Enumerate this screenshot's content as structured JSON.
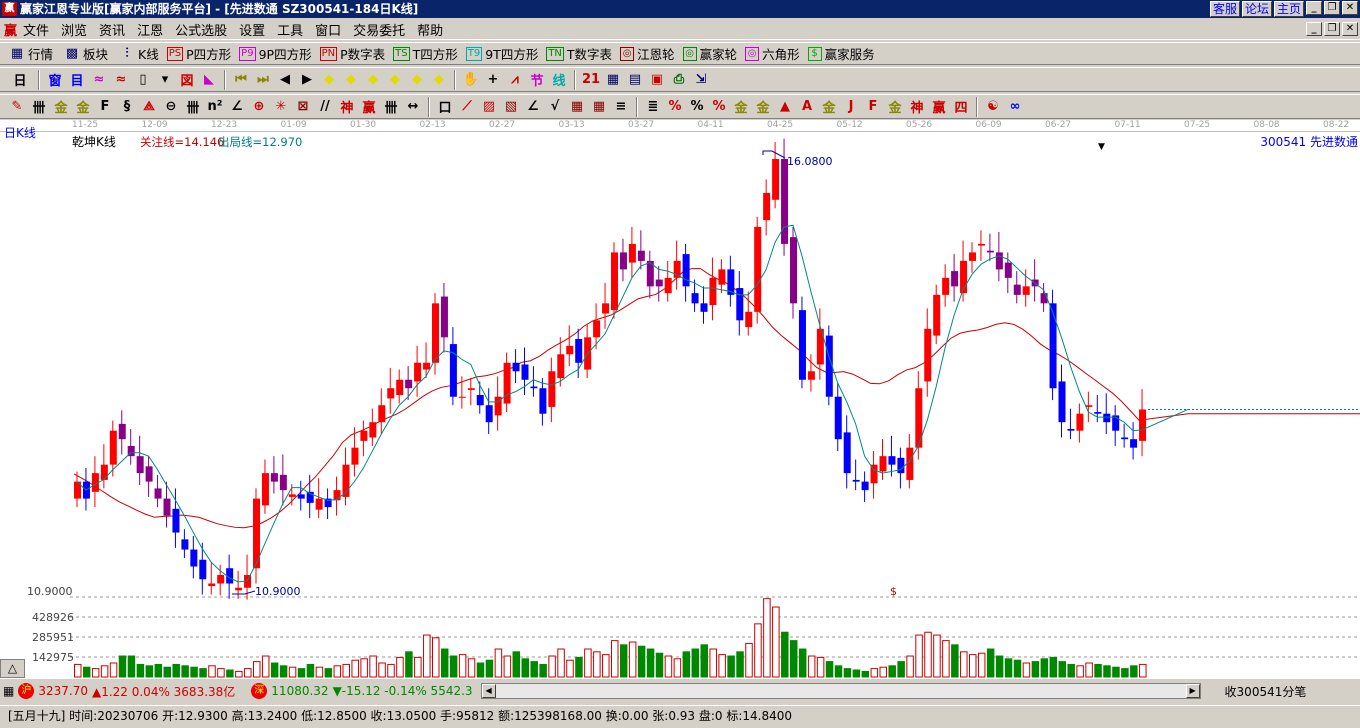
{
  "window": {
    "title": "赢家江恩专业版[赢家内部服务平台] - [先进数通   SZ300541-184日K线]",
    "logo": "赢",
    "links": [
      "客服",
      "论坛",
      "主页"
    ]
  },
  "menu": {
    "logo": "赢",
    "items": [
      "文件",
      "浏览",
      "资讯",
      "江恩",
      "公式选股",
      "设置",
      "工具",
      "窗口",
      "交易委托",
      "帮助"
    ]
  },
  "toolbar1": [
    {
      "icon": "PS",
      "label": "P四方形",
      "color": "#c00"
    },
    {
      "icon": "P9",
      "label": "9P四方形",
      "color": "#c0c"
    },
    {
      "icon": "PN",
      "label": "P数字表",
      "color": "#c00"
    },
    {
      "icon": "TS",
      "label": "T四方形",
      "color": "#080"
    },
    {
      "icon": "T9",
      "label": "9T四方形",
      "color": "#0aa"
    },
    {
      "icon": "TN",
      "label": "T数字表",
      "color": "#080"
    },
    {
      "icon": "◎",
      "label": "江恩轮",
      "color": "#800"
    },
    {
      "icon": "◎",
      "label": "赢家轮",
      "color": "#080"
    },
    {
      "icon": "◎",
      "label": "六角形",
      "color": "#c0c"
    },
    {
      "icon": "$",
      "label": "赢家服务",
      "color": "#0a0"
    }
  ],
  "toolbar1_fixed": [
    {
      "icon": "▦",
      "label": "行情"
    },
    {
      "icon": "▩",
      "label": "板块"
    },
    {
      "icon": "⫶",
      "label": "K线"
    }
  ],
  "toolbar2": {
    "period": "日",
    "icons": [
      [
        "window-icon",
        "窗",
        "#00f"
      ],
      [
        "notes-icon",
        "目",
        "#00f"
      ],
      [
        "wave3-icon",
        "≈",
        "#c0c"
      ],
      [
        "wave9-icon",
        "≈",
        "#c00"
      ],
      [
        "candle-icon",
        "▯",
        "#000"
      ],
      [
        "select-icon",
        "▾",
        "#000"
      ],
      [
        "indicator-icon",
        "図",
        "#c00"
      ],
      [
        "flag-icon",
        "◣",
        "#c0c"
      ],
      [
        "|sep",
        "",
        ""
      ],
      [
        "first-icon",
        "⏮",
        "#880"
      ],
      [
        "last-icon",
        "⏭",
        "#880"
      ],
      [
        "prev-icon",
        "◀",
        "#000"
      ],
      [
        "next-icon",
        "▶",
        "#000"
      ],
      [
        "left-icon",
        "◆",
        "#dd0"
      ],
      [
        "right-icon",
        "◆",
        "#dd0"
      ],
      [
        "expand-icon",
        "◆",
        "#dd0"
      ],
      [
        "shrink-icon",
        "◆",
        "#dd0"
      ],
      [
        "zoom-in-icon",
        "◆",
        "#dd0"
      ],
      [
        "zoom-out-icon",
        "◆",
        "#dd0"
      ],
      [
        "|sep",
        "",
        ""
      ],
      [
        "hand-icon",
        "✋",
        "#000"
      ],
      [
        "cross-icon",
        "+",
        "#000"
      ],
      [
        "line-icon",
        "⩘",
        "#c00"
      ],
      [
        "jie-icon",
        "节",
        "#c0c"
      ],
      [
        "fen-icon",
        "线",
        "#0aa"
      ],
      [
        "|sep",
        "",
        ""
      ],
      [
        "calendar-icon",
        "21",
        "#c00"
      ],
      [
        "calculator-icon",
        "▦",
        "#006"
      ],
      [
        "report-icon",
        "▤",
        "#006"
      ],
      [
        "save-icon",
        "▣",
        "#c00"
      ],
      [
        "print-icon",
        "⎙",
        "#060"
      ],
      [
        "export-icon",
        "⇲",
        "#006"
      ]
    ]
  },
  "toolbar3": {
    "icons": [
      [
        "pen-icon",
        "✎",
        "#c00"
      ],
      [
        "parallel-icon",
        "卌",
        "#000"
      ],
      [
        "gold1-icon",
        "金",
        "#880"
      ],
      [
        "gold2-icon",
        "金",
        "#880"
      ],
      [
        "fib-icon",
        "F",
        "#000"
      ],
      [
        "spiral-icon",
        "§",
        "#000"
      ],
      [
        "fan-icon",
        "⟁",
        "#c00"
      ],
      [
        "circle-icon",
        "⊖",
        "#000"
      ],
      [
        "grid-icon",
        "卌",
        "#000"
      ],
      [
        "n2-icon",
        "n²",
        "#000"
      ],
      [
        "angle-icon",
        "∠",
        "#000"
      ],
      [
        "target-icon",
        "⊕",
        "#c00"
      ],
      [
        "star-icon",
        "✳",
        "#c00"
      ],
      [
        "box-icon",
        "⊠",
        "#800"
      ],
      [
        "slash-icon",
        "//",
        "#000"
      ],
      [
        "shen-icon",
        "神",
        "#c00"
      ],
      [
        "ying-icon",
        "赢",
        "#c00"
      ],
      [
        "comb-icon",
        "卌",
        "#000"
      ],
      [
        "measure-icon",
        "↔",
        "#000"
      ],
      [
        "|sep",
        "",
        ""
      ],
      [
        "rect-icon",
        "口",
        "#000"
      ],
      [
        "ray-icon",
        "⟋",
        "#c00"
      ],
      [
        "speed-icon",
        "▨",
        "#c00"
      ],
      [
        "arc-icon",
        "▧",
        "#800"
      ],
      [
        "fan2-icon",
        "∠",
        "#000"
      ],
      [
        "v-icon",
        "√",
        "#000"
      ],
      [
        "grid2-icon",
        "▦",
        "#800"
      ],
      [
        "grid3-icon",
        "▦",
        "#800"
      ],
      [
        "channel-icon",
        "≡",
        "#000"
      ],
      [
        "|sep",
        "",
        ""
      ],
      [
        "ruler-icon",
        "≣",
        "#000"
      ],
      [
        "pct1-icon",
        "%",
        "#c00"
      ],
      [
        "pct2-icon",
        "%",
        "#000"
      ],
      [
        "pct3-icon",
        "%",
        "#c00"
      ],
      [
        "gold3-icon",
        "金",
        "#880"
      ],
      [
        "gold4-icon",
        "金",
        "#880"
      ],
      [
        "drop-icon",
        "▲",
        "#c00"
      ],
      [
        "ab-icon",
        "A",
        "#c00"
      ],
      [
        "gold5-icon",
        "金",
        "#880"
      ],
      [
        "j-icon",
        "J",
        "#c00"
      ],
      [
        "f-icon",
        "F",
        "#c00"
      ],
      [
        "gold6-icon",
        "金",
        "#880"
      ],
      [
        "shen2-icon",
        "神",
        "#c00"
      ],
      [
        "ying2-icon",
        "赢",
        "#c00"
      ],
      [
        "si-icon",
        "四",
        "#c00"
      ],
      [
        "|sep",
        "",
        ""
      ],
      [
        "yinyang-icon",
        "☯",
        "#c00"
      ],
      [
        "infinity-icon",
        "∞",
        "#00f"
      ]
    ]
  },
  "chart": {
    "period_label": "日K线",
    "indicator": "乾坤K线",
    "focus_line": "关注线=14.146",
    "exit_line": "出局线=12.970",
    "code_name": "300541  先进数通",
    "dates": [
      "11-25",
      "12-09",
      "12-23",
      "01-09",
      "01-30",
      "02-13",
      "02-27",
      "03-13",
      "03-27",
      "04-11",
      "04-25",
      "05-12",
      "05-26",
      "06-09",
      "06-27",
      "07-11",
      "07-25",
      "08-08",
      "08-22"
    ],
    "high_label": "16.0800",
    "low_label": "10.9000",
    "low_axis": "10.9000",
    "marker": "$",
    "vol_axis": [
      "428926",
      "285951",
      "142975"
    ],
    "expand_button": "△"
  },
  "chart_data": {
    "type": "candlestick",
    "high": 16.08,
    "low": 10.9,
    "close": [
      12.2,
      12.0,
      12.3,
      12.4,
      12.8,
      12.7,
      12.5,
      12.3,
      12.2,
      12.0,
      11.8,
      11.6,
      11.4,
      11.2,
      11.05,
      11.0,
      11.1,
      11.0,
      10.95,
      11.1,
      12.0,
      12.3,
      12.2,
      12.1,
      12.05,
      12.0,
      11.95,
      12.0,
      11.9,
      12.1,
      12.4,
      12.6,
      12.8,
      12.9,
      13.1,
      13.3,
      13.4,
      13.3,
      13.6,
      13.6,
      14.3,
      13.9,
      13.2,
      13.2,
      13.3,
      13.1,
      12.9,
      13.2,
      13.6,
      13.5,
      13.4,
      13.3,
      13.0,
      13.5,
      13.7,
      13.8,
      13.6,
      13.9,
      14.1,
      14.3,
      14.9,
      14.7,
      15.0,
      14.8,
      14.5,
      14.5,
      14.6,
      14.8,
      14.5,
      14.3,
      14.2,
      14.6,
      14.7,
      14.4,
      14.1,
      14.2,
      15.2,
      15.6,
      16.0,
      15.0,
      14.3,
      13.4,
      13.5,
      14.0,
      13.2,
      12.7,
      12.3,
      12.2,
      12.1,
      12.4,
      12.5,
      12.4,
      12.3,
      12.6,
      13.3,
      14.0,
      14.4,
      14.6,
      14.5,
      14.8,
      14.9,
      15.0,
      14.9,
      14.7,
      14.6,
      14.4,
      14.5,
      14.5,
      14.3,
      13.3,
      12.9,
      12.8,
      13.0,
      13.1,
      13.0,
      12.9,
      12.8,
      12.7,
      12.6,
      13.05
    ],
    "volume_k": [
      90,
      70,
      60,
      80,
      100,
      150,
      150,
      90,
      80,
      90,
      70,
      90,
      80,
      70,
      60,
      80,
      60,
      50,
      40,
      60,
      110,
      150,
      100,
      80,
      70,
      60,
      90,
      70,
      60,
      80,
      90,
      120,
      130,
      150,
      100,
      90,
      140,
      180,
      140,
      300,
      280,
      200,
      150,
      160,
      130,
      100,
      120,
      200,
      150,
      180,
      130,
      110,
      90,
      150,
      200,
      120,
      140,
      200,
      180,
      160,
      260,
      230,
      250,
      220,
      200,
      170,
      150,
      130,
      180,
      200,
      230,
      200,
      160,
      150,
      180,
      240,
      380,
      560,
      500,
      320,
      260,
      200,
      150,
      140,
      110,
      80,
      60,
      50,
      40,
      60,
      70,
      80,
      110,
      150,
      300,
      320,
      300,
      260,
      230,
      180,
      160,
      170,
      200,
      150,
      130,
      120,
      100,
      110,
      130,
      140,
      110,
      90,
      80,
      100,
      90,
      80,
      70,
      60,
      80,
      90
    ]
  },
  "status1": {
    "sh_badge": "沪",
    "sh": "3237.70",
    "sh_chg": "▲1.22 0.04% 3683.38亿",
    "sz_badge": "深",
    "sz": "11080.32",
    "sz_chg": "▼-15.12 -0.14% 5542.3",
    "right": "收300541分笔"
  },
  "status2": "[五月十九] 时间:20230706 开:12.9300 高:13.2400 低:12.8500 收:13.0500 手:95812 额:125398168.00 换:0.00 张:0.93 盘:0 标:14.8400"
}
